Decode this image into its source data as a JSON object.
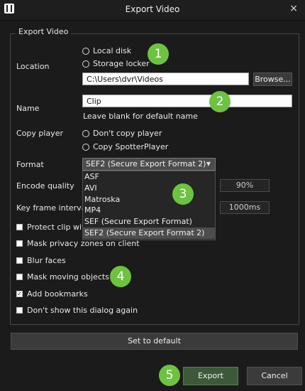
{
  "window": {
    "title": "Export Video",
    "close_glyph": "×",
    "icon": "film-icon"
  },
  "group": {
    "legend": "Export Video"
  },
  "location": {
    "label": "Location",
    "options": [
      "Local disk",
      "Storage locker"
    ],
    "path": "C:\\Users\\dvr\\Videos",
    "browse_label": "Browse..."
  },
  "name": {
    "label": "Name",
    "value": "Clip",
    "hint": "Leave blank for default name"
  },
  "copy_player": {
    "label": "Copy player",
    "options": [
      "Don't copy player",
      "Copy SpotterPlayer"
    ]
  },
  "format": {
    "label": "Format",
    "selected": "SEF2 (Secure Export Format 2)",
    "options": [
      "ASF",
      "AVI",
      "Matroska",
      "MP4",
      "SEF (Secure Export Format)",
      "SEF2 (Secure Export Format 2)"
    ]
  },
  "encode_quality": {
    "label": "Encode quality",
    "value": "90%"
  },
  "key_frame_interval": {
    "label": "Key frame interval",
    "value": "1000ms"
  },
  "checkboxes": [
    {
      "label": "Protect clip with",
      "checked": false
    },
    {
      "label": "Mask privacy zones on client",
      "checked": false
    },
    {
      "label": "Blur faces",
      "checked": false
    },
    {
      "label": "Mask moving objects",
      "checked": false
    },
    {
      "label": "Add bookmarks",
      "checked": true
    },
    {
      "label": "Don't show this dialog again",
      "checked": false
    }
  ],
  "checkmark_glyph": "✓",
  "buttons": {
    "set_default": "Set to default",
    "export": "Export",
    "cancel": "Cancel"
  },
  "callouts": [
    "1",
    "2",
    "3",
    "4",
    "5"
  ],
  "colors": {
    "callout": "#6ec241",
    "export_button": "#3c5a3a",
    "background": "#1b1b1b"
  }
}
